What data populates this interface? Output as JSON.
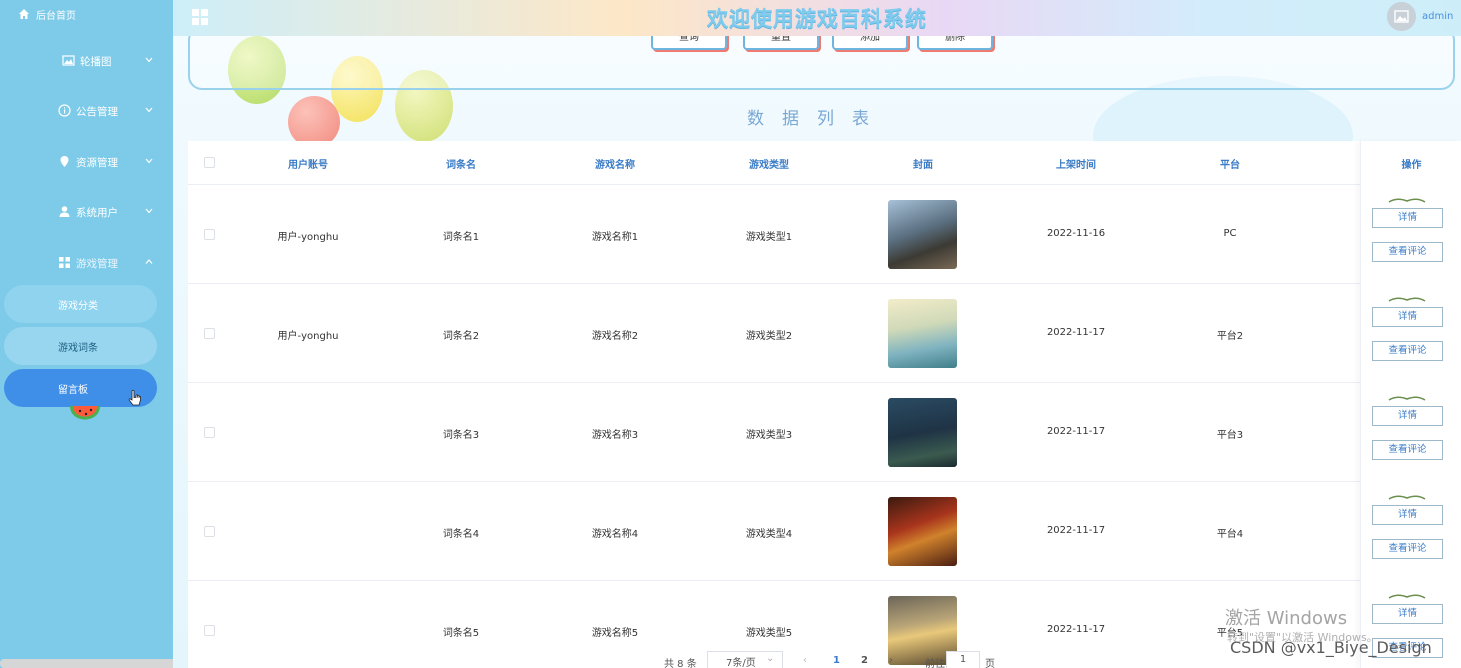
{
  "sidebar": {
    "home_label": "后台首页",
    "items": [
      {
        "label": "轮播图",
        "icon": "image-icon"
      },
      {
        "label": "公告管理",
        "icon": "info-icon"
      },
      {
        "label": "资源管理",
        "icon": "location-icon"
      },
      {
        "label": "系统用户",
        "icon": "user-icon"
      },
      {
        "label": "游戏管理",
        "icon": "grid-icon"
      }
    ],
    "sub_items": [
      {
        "label": "游戏分类"
      },
      {
        "label": "游戏词条"
      },
      {
        "label": "留言板"
      }
    ]
  },
  "header": {
    "title": "欢迎使用游戏百科系统",
    "user": "admin"
  },
  "search": {
    "buttons": {
      "query": "查询",
      "reset": "重置",
      "add": "添加",
      "delete": "删除"
    }
  },
  "section_title": "数据列表",
  "table": {
    "columns": {
      "account": "用户账号",
      "entry": "词条名",
      "game_name": "游戏名称",
      "game_type": "游戏类型",
      "cover": "封面",
      "date": "上架时间",
      "platform": "平台",
      "actions": "操作"
    },
    "rows": [
      {
        "account": "用户-yonghu",
        "entry": "词条名1",
        "game_name": "游戏名称1",
        "game_type": "游戏类型1",
        "date": "2022-11-16",
        "platform": "PC"
      },
      {
        "account": "用户-yonghu",
        "entry": "词条名2",
        "game_name": "游戏名称2",
        "game_type": "游戏类型2",
        "date": "2022-11-17",
        "platform": "平台2"
      },
      {
        "account": "",
        "entry": "词条名3",
        "game_name": "游戏名称3",
        "game_type": "游戏类型3",
        "date": "2022-11-17",
        "platform": "平台3"
      },
      {
        "account": "",
        "entry": "词条名4",
        "game_name": "游戏名称4",
        "game_type": "游戏类型4",
        "date": "2022-11-17",
        "platform": "平台4"
      },
      {
        "account": "",
        "entry": "词条名5",
        "game_name": "游戏名称5",
        "game_type": "游戏类型5",
        "date": "2022-11-17",
        "platform": "平台5"
      }
    ],
    "detail_label": "详情",
    "comments_label": "查看评论"
  },
  "pagination": {
    "total": "共 8 条",
    "page_size": "7条/页",
    "page1": "1",
    "page2": "2",
    "goto_prefix": "前往",
    "goto_value": "1",
    "goto_suffix": "页"
  },
  "watermark": {
    "activate_title": "激活 Windows",
    "activate_sub": "转到\"设置\"以激活 Windows。",
    "csdn": "CSDN @vx1_Biye_Design"
  }
}
